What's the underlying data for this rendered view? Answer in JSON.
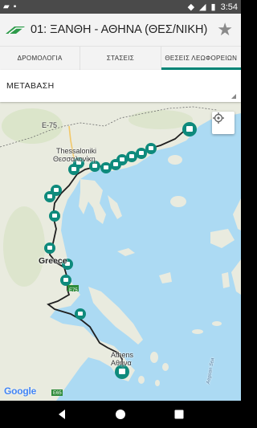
{
  "status": {
    "time": "3:54"
  },
  "appbar": {
    "title": "01: ΞΑΝΘΗ - ΑΘΗΝΑ (ΘΕΣ/ΝΙΚΗ)",
    "favorite_icon": "star-icon"
  },
  "tabs": [
    {
      "label": "ΔΡΟΜΟΛΟΓΙΑ",
      "active": false
    },
    {
      "label": "ΣΤΑΣΕΙΣ",
      "active": false
    },
    {
      "label": "ΘΕΣΕΙΣ ΛΕΩΦΟΡΕΙΩΝ",
      "active": true
    }
  ],
  "select": {
    "value": "ΜΕΤΑΒΑΣΗ"
  },
  "map": {
    "labels": {
      "e75_north": "E-75",
      "thessaloniki_en": "Thessaloniki",
      "thessaloniki_gr": "Θεσσαλονίκη",
      "greece": "Greece",
      "e75_south": "E75",
      "athens_en": "Athens",
      "athens_gr": "Αθήνα",
      "e65": "E65",
      "aegean": "Aegean Sea"
    },
    "attribution": "Google",
    "route_color": "#1f1f1f",
    "marker_color": "#0e8a7c"
  }
}
